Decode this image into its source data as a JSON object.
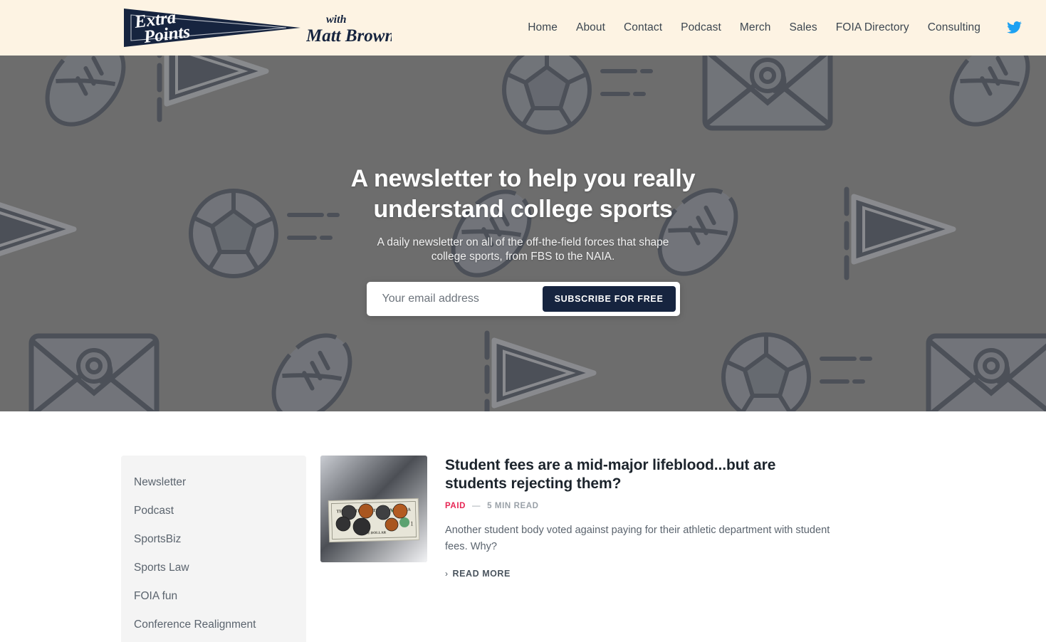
{
  "header": {
    "logo": {
      "pennant_line1": "Extra",
      "pennant_line2": "Points",
      "with_word": "with",
      "author": "Matt Brown",
      "alt": "Extra Points with Matt Brown"
    },
    "nav": [
      {
        "label": "Home"
      },
      {
        "label": "About"
      },
      {
        "label": "Contact"
      },
      {
        "label": "Podcast"
      },
      {
        "label": "Merch"
      },
      {
        "label": "Sales"
      },
      {
        "label": "FOIA Directory"
      },
      {
        "label": "Consulting"
      }
    ],
    "social": {
      "twitter_label": "Twitter"
    },
    "background_color": "#fdf3e3"
  },
  "hero": {
    "title": "A newsletter to help you really understand college sports",
    "subtitle": "A daily newsletter on all of the off-the-field forces that shape college sports, from FBS to the NAIA.",
    "form": {
      "email_placeholder": "Your email address",
      "email_value": "",
      "submit_label": "SUBSCRIBE FOR FREE"
    },
    "overlay_color": "#6d6d6d",
    "pattern_ink": "#111d33"
  },
  "sidebar": {
    "items": [
      {
        "label": "Newsletter"
      },
      {
        "label": "Podcast"
      },
      {
        "label": "SportsBiz"
      },
      {
        "label": "Sports Law"
      },
      {
        "label": "FOIA fun"
      },
      {
        "label": "Conference Realignment"
      }
    ],
    "background_color": "#f4f4f4"
  },
  "posts": [
    {
      "title": "Student fees are a mid-major lifeblood...but are students rejecting them?",
      "badge": "PAID",
      "separator": "—",
      "read_time": "5 MIN READ",
      "excerpt": "Another student body voted against paying for their athletic department with student fees. Why?",
      "read_more": "READ MORE",
      "thumbnail_alt": "dollar bill with coins",
      "badge_color": "#e72654"
    }
  ]
}
